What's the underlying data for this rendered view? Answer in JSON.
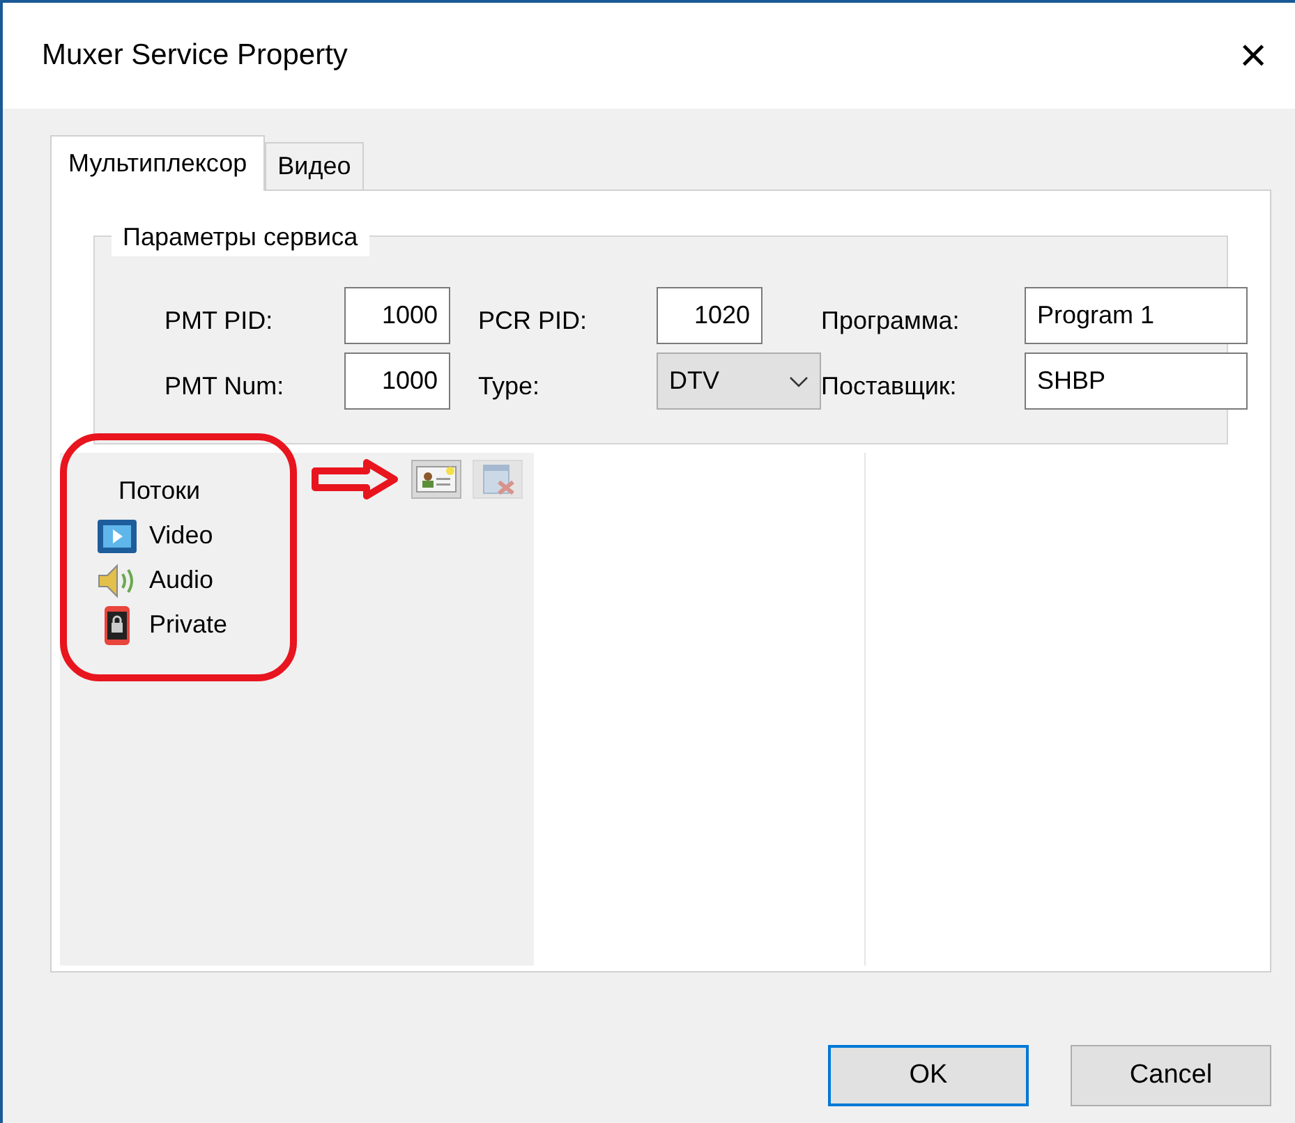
{
  "window": {
    "title": "Muxer Service Property",
    "close": "×"
  },
  "tabs": [
    {
      "label": "Мультиплексор",
      "selected": true
    },
    {
      "label": "Видео",
      "selected": false
    }
  ],
  "service_group": {
    "title": "Параметры сервиса",
    "rows": [
      [
        {
          "label": "PMT PID:",
          "kind": "number",
          "value": "1000"
        },
        {
          "label": "PCR PID:",
          "kind": "number",
          "value": "1020"
        },
        {
          "label": "Программа:",
          "kind": "text",
          "value": "Program 1"
        }
      ],
      [
        {
          "label": "PMT Num:",
          "kind": "number",
          "value": "1000"
        },
        {
          "label": "Type:",
          "kind": "select",
          "value": "DTV"
        },
        {
          "label": "Поставщик:",
          "kind": "text",
          "value": "SHBP"
        }
      ]
    ]
  },
  "streams": {
    "title": "Потоки",
    "children": [
      {
        "label": "Video",
        "kind": "video"
      },
      {
        "label": "Audio",
        "kind": "audio"
      },
      {
        "label": "Private",
        "kind": "private"
      }
    ]
  },
  "stream_toolbar": [
    {
      "kind": "add",
      "disabled": false
    },
    {
      "kind": "remove",
      "disabled": true
    }
  ],
  "buttons": [
    {
      "label": "OK",
      "default": true
    },
    {
      "label": "Cancel",
      "default": false
    }
  ]
}
